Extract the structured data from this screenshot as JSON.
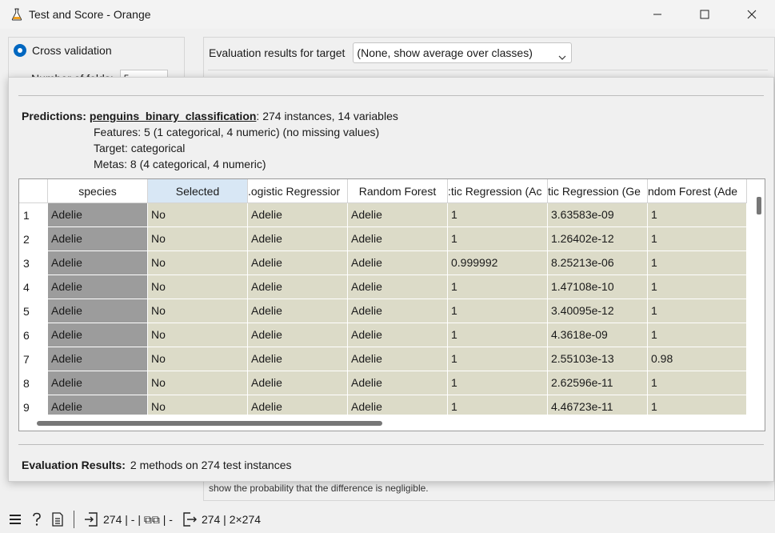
{
  "window": {
    "title": "Test and Score - Orange",
    "app_icon": "flask-icon"
  },
  "left_panel": {
    "cross_validation_label": "Cross validation",
    "folds_label": "Number of folds:",
    "folds_value": "5"
  },
  "right_panel": {
    "eval_target_label": "Evaluation results for target",
    "eval_target_value": "(None, show average over classes)",
    "note_text": "show the probability that the difference is negligible."
  },
  "popup": {
    "predictions_label": "Predictions:",
    "dataset_name": "penguins_binary_classification",
    "dataset_summary": ": 274 instances, 14 variables",
    "features": "Features: 5 (1 categorical, 4 numeric) (no missing values)",
    "target": "Target: categorical",
    "metas": "Metas: 8 (4 categorical, 4 numeric)",
    "eval_results_label": "Evaluation Results:",
    "eval_results_text": "2 methods on 274 test instances"
  },
  "table": {
    "columns": [
      "species",
      "Selected",
      "Logistic Regression",
      "Random Forest",
      "Logistic Regression (Ad",
      "Logistic Regression (Ge",
      "Random Forest (Ade"
    ],
    "column_display": [
      "species",
      "Selected",
      ".ogistic Regressior",
      "Random Forest",
      ":tic Regression (Ac",
      "tic Regression (Ge",
      "ndom Forest (Ade"
    ],
    "rows": [
      {
        "n": "1",
        "cells": [
          "Adelie",
          "No",
          "Adelie",
          "Adelie",
          "1",
          "3.63583e-09",
          "1"
        ]
      },
      {
        "n": "2",
        "cells": [
          "Adelie",
          "No",
          "Adelie",
          "Adelie",
          "1",
          "1.26402e-12",
          "1"
        ]
      },
      {
        "n": "3",
        "cells": [
          "Adelie",
          "No",
          "Adelie",
          "Adelie",
          "0.999992",
          "8.25213e-06",
          "1"
        ]
      },
      {
        "n": "4",
        "cells": [
          "Adelie",
          "No",
          "Adelie",
          "Adelie",
          "1",
          "1.47108e-10",
          "1"
        ]
      },
      {
        "n": "5",
        "cells": [
          "Adelie",
          "No",
          "Adelie",
          "Adelie",
          "1",
          "3.40095e-12",
          "1"
        ]
      },
      {
        "n": "6",
        "cells": [
          "Adelie",
          "No",
          "Adelie",
          "Adelie",
          "1",
          "4.3618e-09",
          "1"
        ]
      },
      {
        "n": "7",
        "cells": [
          "Adelie",
          "No",
          "Adelie",
          "Adelie",
          "1",
          "2.55103e-13",
          "0.98"
        ]
      },
      {
        "n": "8",
        "cells": [
          "Adelie",
          "No",
          "Adelie",
          "Adelie",
          "1",
          "2.62596e-11",
          "1"
        ]
      },
      {
        "n": "9",
        "cells": [
          "Adelie",
          "No",
          "Adelie",
          "Adelie",
          "1",
          "4.46723e-11",
          "1"
        ]
      }
    ]
  },
  "statusbar": {
    "input_summary": "274 | - | ⧉⧉ | -",
    "output_summary": "274 | 2×274"
  },
  "colors": {
    "accent": "#0067c0",
    "cell_bg": "#dcdbc8",
    "dark_cell_bg": "#9c9c9c",
    "selected_header_bg": "#d8e7f5"
  }
}
